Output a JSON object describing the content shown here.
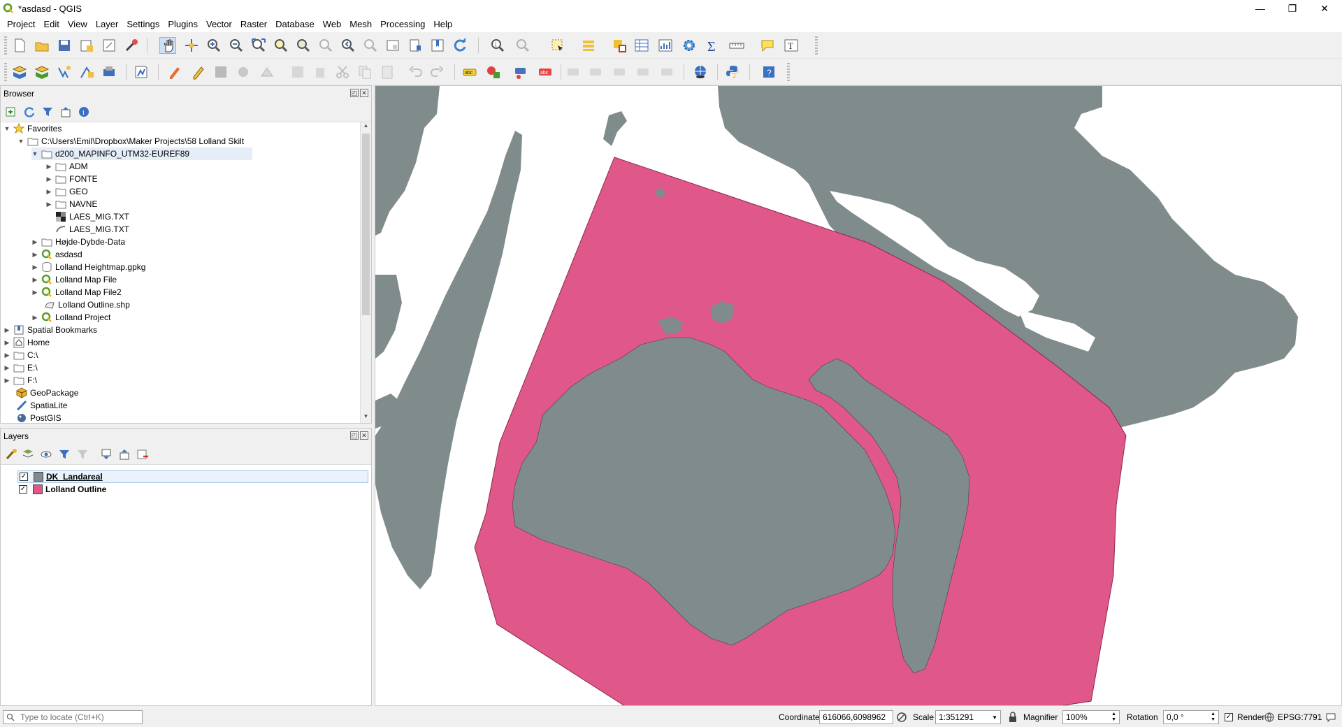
{
  "window": {
    "title": "*asdasd - QGIS",
    "minimize": "—",
    "restore": "❐",
    "close": "✕"
  },
  "menu": [
    "Project",
    "Edit",
    "View",
    "Layer",
    "Settings",
    "Plugins",
    "Vector",
    "Raster",
    "Database",
    "Web",
    "Mesh",
    "Processing",
    "Help"
  ],
  "browser": {
    "title": "Browser",
    "items": [
      {
        "label": "Favorites",
        "icon": "star-icon",
        "expanded": true
      },
      {
        "label": "C:\\Users\\Emil\\Dropbox\\Maker Projects\\58 Lolland Skilt",
        "icon": "folder-icon",
        "expanded": true
      },
      {
        "label": "d200_MAPINFO_UTM32-EUREF89",
        "icon": "folder-icon",
        "expanded": true,
        "selected": true
      },
      {
        "label": "ADM",
        "icon": "folder-icon"
      },
      {
        "label": "FONTE",
        "icon": "folder-icon"
      },
      {
        "label": "GEO",
        "icon": "folder-icon"
      },
      {
        "label": "NAVNE",
        "icon": "folder-icon"
      },
      {
        "label": "LAES_MIG.TXT",
        "icon": "raster-icon"
      },
      {
        "label": "LAES_MIG.TXT",
        "icon": "vector-icon"
      },
      {
        "label": "Højde-Dybde-Data",
        "icon": "folder-icon"
      },
      {
        "label": "asdasd",
        "icon": "qgis-project-icon"
      },
      {
        "label": "Lolland Heightmap.gpkg",
        "icon": "database-icon"
      },
      {
        "label": "Lolland Map File",
        "icon": "qgis-project-icon"
      },
      {
        "label": "Lolland Map File2",
        "icon": "qgis-project-icon"
      },
      {
        "label": "Lolland Outline.shp",
        "icon": "polygon-icon"
      },
      {
        "label": "Lolland Project",
        "icon": "qgis-project-icon"
      },
      {
        "label": "Spatial Bookmarks",
        "icon": "bookmark-icon"
      },
      {
        "label": "Home",
        "icon": "home-icon"
      },
      {
        "label": "C:\\",
        "icon": "drive-icon"
      },
      {
        "label": "E:\\",
        "icon": "drive-icon"
      },
      {
        "label": "F:\\",
        "icon": "drive-icon"
      },
      {
        "label": "GeoPackage",
        "icon": "geopackage-icon"
      },
      {
        "label": "SpatiaLite",
        "icon": "spatialite-icon"
      },
      {
        "label": "PostGIS",
        "icon": "postgis-icon"
      }
    ]
  },
  "layers": {
    "title": "Layers",
    "items": [
      {
        "label": "DK_Landareal",
        "color": "#808b8c",
        "checked": true
      },
      {
        "label": "Lolland Outline",
        "color": "#e0578a",
        "checked": true
      }
    ]
  },
  "status": {
    "locate_placeholder": "Type to locate (Ctrl+K)",
    "coordinate_label": "Coordinate",
    "coordinate_value": "616066,6098962",
    "scale_label": "Scale",
    "scale_value": "1:351291",
    "magnifier_label": "Magnifier",
    "magnifier_value": "100%",
    "rotation_label": "Rotation",
    "rotation_value": "0,0 °",
    "render_label": "Render",
    "crs_label": "EPSG:7791"
  },
  "colors": {
    "land": "#808b8c",
    "outline": "#e0578a",
    "accent": "#3b7dd8"
  }
}
